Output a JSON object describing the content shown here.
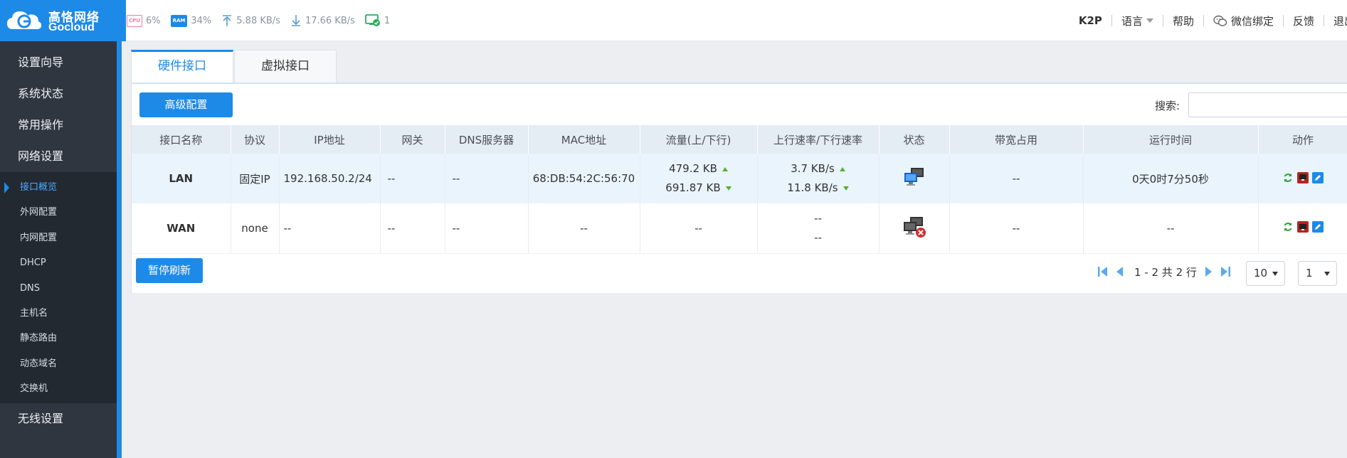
{
  "brand": {
    "name_cn": "高恪网络",
    "name_en": "Gocloud",
    "color": "#1d8ae8"
  },
  "stats": {
    "cpu": {
      "chip": "CPU",
      "value": "6%"
    },
    "ram": {
      "chip": "RAM",
      "value": "34%"
    },
    "upload": "5.88 KB/s",
    "download": "17.66 KB/s",
    "devices": "1"
  },
  "topnav": {
    "model": "K2P",
    "language": "语言",
    "help": "帮助",
    "wechat": "微信绑定",
    "feedback": "反馈",
    "logout": "退出"
  },
  "sidebar": {
    "groups_top": [
      "设置向导",
      "系统状态",
      "常用操作",
      "网络设置"
    ],
    "subitems": [
      "接口概览",
      "外网配置",
      "内网配置",
      "DHCP",
      "DNS",
      "主机名",
      "静态路由",
      "动态域名",
      "交换机"
    ],
    "active_subitem": "接口概览",
    "groups_bottom": [
      "无线设置"
    ]
  },
  "tabs": [
    {
      "label": "硬件接口",
      "active": true
    },
    {
      "label": "虚拟接口",
      "active": false
    }
  ],
  "toolbar": {
    "advanced_label": "高级配置",
    "search_label": "搜索:",
    "search_value": ""
  },
  "table": {
    "columns": [
      "接口名称",
      "协议",
      "IP地址",
      "网关",
      "DNS服务器",
      "MAC地址",
      "流量(上/下行)",
      "上行速率/下行速率",
      "状态",
      "带宽占用",
      "运行时间",
      "动作"
    ],
    "rows": [
      {
        "name": "LAN",
        "protocol": "固定IP",
        "ip": "192.168.50.2/24",
        "gateway": "--",
        "dns": "--",
        "mac": "68:DB:54:2C:56:70",
        "traffic_up": "479.2 KB",
        "traffic_down": "691.87 KB",
        "rate_up": "3.7 KB/s",
        "rate_down": "11.8 KB/s",
        "status_icon": "connected-icon",
        "bandwidth": "--",
        "uptime": "0天0时7分50秒"
      },
      {
        "name": "WAN",
        "protocol": "none",
        "ip": "--",
        "gateway": "--",
        "dns": "--",
        "mac": "--",
        "traffic": "--",
        "rate_up": "--",
        "rate_down": "--",
        "status_icon": "disconnected-icon",
        "bandwidth": "--",
        "uptime": "--"
      }
    ]
  },
  "footer": {
    "pause_label": "暂停刷新",
    "pager_text": "1 - 2 共 2 行",
    "page_size": "10",
    "page_number": "1"
  }
}
